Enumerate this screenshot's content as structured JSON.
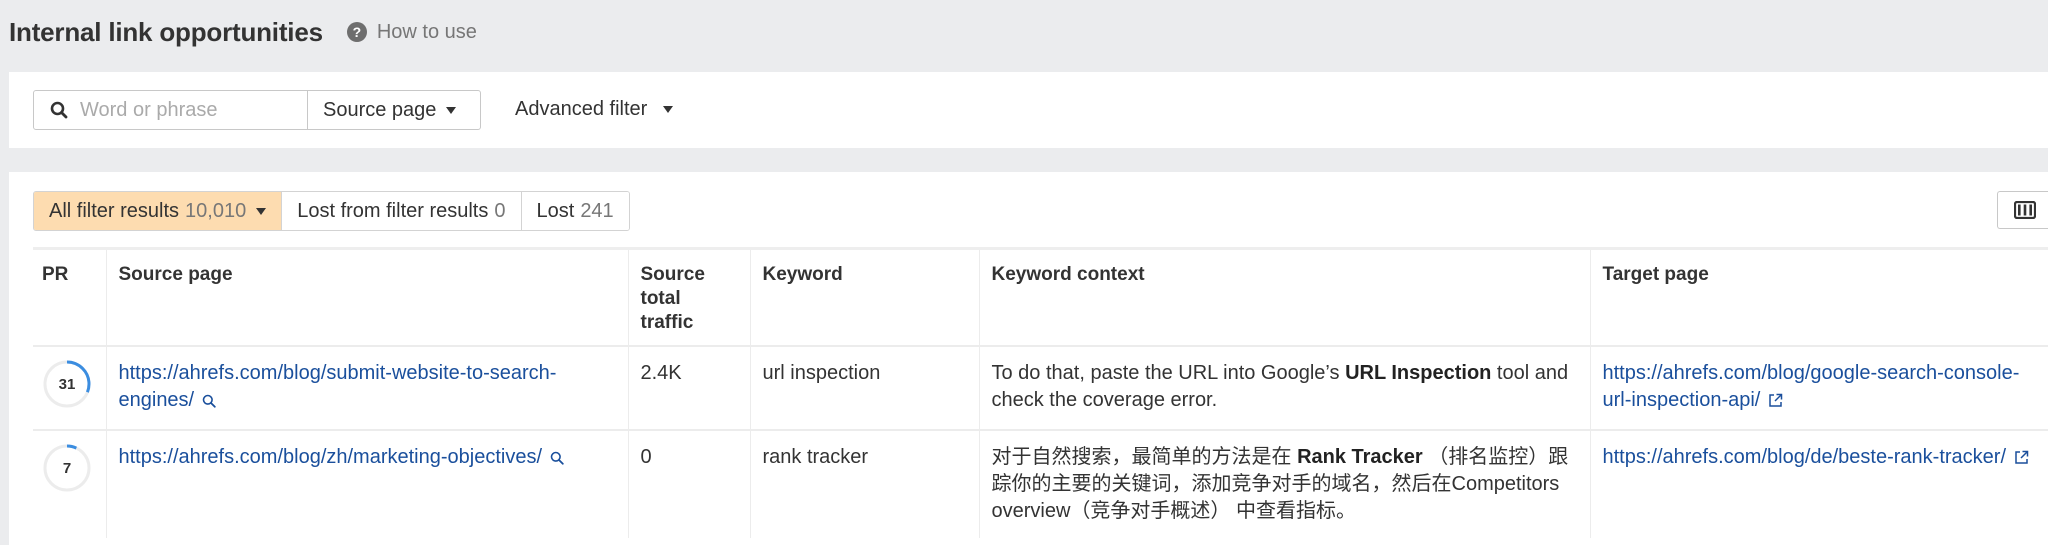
{
  "header": {
    "title": "Internal link opportunities",
    "help_label": "How to use",
    "help_icon": "question-circle-icon"
  },
  "filters": {
    "search_placeholder": "Word or phrase",
    "search_value": "",
    "search_icon": "search-icon",
    "scope_select": "Source page",
    "advanced_filter_label": "Advanced filter"
  },
  "tabs": [
    {
      "label": "All filter results",
      "count": "10,010",
      "active": true
    },
    {
      "label": "Lost from filter results",
      "count": "0",
      "active": false
    },
    {
      "label": "Lost",
      "count": "241",
      "active": false
    }
  ],
  "columns_button_icon": "columns-icon",
  "table": {
    "headers": [
      "PR",
      "Source page",
      "Source total traffic",
      "Keyword",
      "Keyword context",
      "Target page"
    ],
    "rows": [
      {
        "pr": 31,
        "source_page": "https://ahrefs.com/blog/submit-website-to-search-engines/",
        "source_traffic": "2.4K",
        "keyword": "url inspection",
        "context_before": "To do that, paste the URL into Google’s ",
        "context_bold": "URL Inspection",
        "context_after": " tool and check the coverage error.",
        "target_page": "https://ahrefs.com/blog/google-search-console-url-inspection-api/"
      },
      {
        "pr": 7,
        "source_page": "https://ahrefs.com/blog/zh/marketing-objectives/",
        "source_traffic": "0",
        "keyword": "rank tracker",
        "context_before": "对于自然搜索，最简单的方法是在 ",
        "context_bold": "Rank Tracker",
        "context_after": " （排名监控）跟踪你的主要的关键词，添加竞争对手的域名，然后在Competitors overview（竞争对手概述） 中查看指标。",
        "target_page": "https://ahrefs.com/blog/de/beste-rank-tracker/"
      }
    ]
  },
  "colors": {
    "background": "#ebecee",
    "link": "#1a4f9c",
    "active_tab": "#fddcb0",
    "pr_ring": "#3b8de0",
    "pr_track": "#ececec"
  }
}
